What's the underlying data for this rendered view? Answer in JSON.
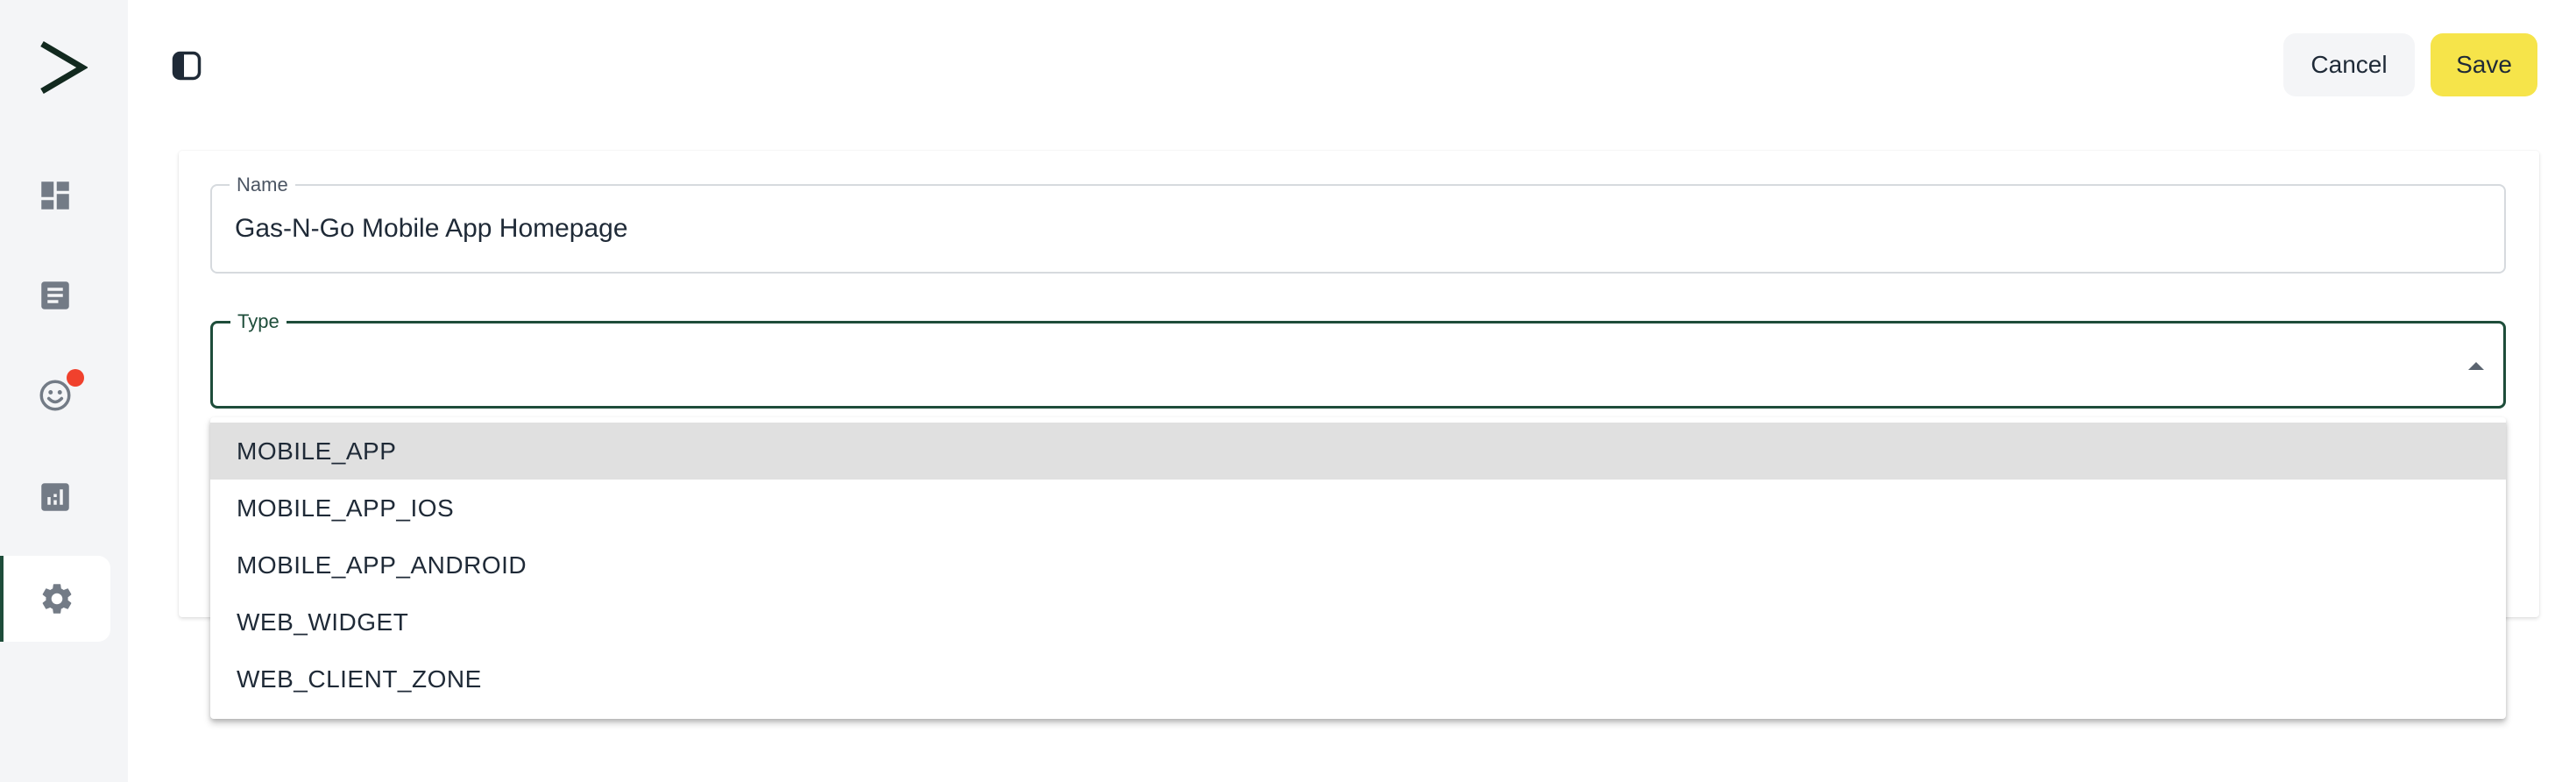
{
  "sidebar": {
    "items": [
      {
        "name": "dashboard",
        "icon": "dashboard-icon",
        "active": false
      },
      {
        "name": "articles",
        "icon": "article-icon",
        "active": false
      },
      {
        "name": "feedback",
        "icon": "smiley-icon",
        "active": false,
        "has_notification": true
      },
      {
        "name": "reports",
        "icon": "analytics-icon",
        "active": false
      },
      {
        "name": "settings",
        "icon": "gear-icon",
        "active": true
      }
    ],
    "icon_color": "#737b86",
    "accent": "#1e4d3a",
    "badge_color": "#f0412d"
  },
  "header": {
    "cancel_label": "Cancel",
    "save_label": "Save",
    "save_color": "#f6e44a"
  },
  "form": {
    "name_label": "Name",
    "name_value": "Gas-N-Go Mobile App Homepage",
    "type_label": "Type",
    "type_value": ""
  },
  "dropdown": {
    "options": [
      "MOBILE_APP",
      "MOBILE_APP_IOS",
      "MOBILE_APP_ANDROID",
      "WEB_WIDGET",
      "WEB_CLIENT_ZONE"
    ],
    "highlighted": "MOBILE_APP"
  }
}
